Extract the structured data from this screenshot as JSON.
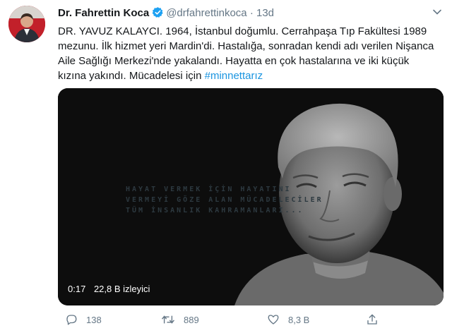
{
  "tweet": {
    "author_name": "Dr. Fahrettin Koca",
    "handle": "@drfahrettinkoca",
    "separator": "·",
    "time": "13d",
    "text": "DR. YAVUZ KALAYCI. 1964, İstanbul doğumlu. Cerrahpaşa Tıp Fakültesi 1989 mezunu. İlk hizmet yeri Mardin'di. Hastalığa, sonradan kendi adı verilen Nişanca Aile Sağlığı Merkezi'nde yakalandı. Hayatta en çok hastalarına ve iki küçük kızına yakındı. Mücadelesi için",
    "hashtag": "#minnettarız"
  },
  "media": {
    "overlay_lines": [
      "HAYAT VERMEK İÇİN HAYATINI",
      "VERMEYİ GÖZE ALAN  MÜCADELECİLER",
      "TÜM İNSANLIK KAHRAMANLARI..."
    ],
    "duration": "0:17",
    "views": "22,8 B izleyici"
  },
  "actions": {
    "replies": "138",
    "retweets": "889",
    "likes": "8,3 B"
  },
  "colors": {
    "accent": "#1b95e0",
    "muted": "#657786",
    "text": "#14171a"
  },
  "icons": [
    "verified-badge-icon",
    "chevron-down-icon",
    "reply-icon",
    "retweet-icon",
    "like-icon",
    "share-icon"
  ]
}
